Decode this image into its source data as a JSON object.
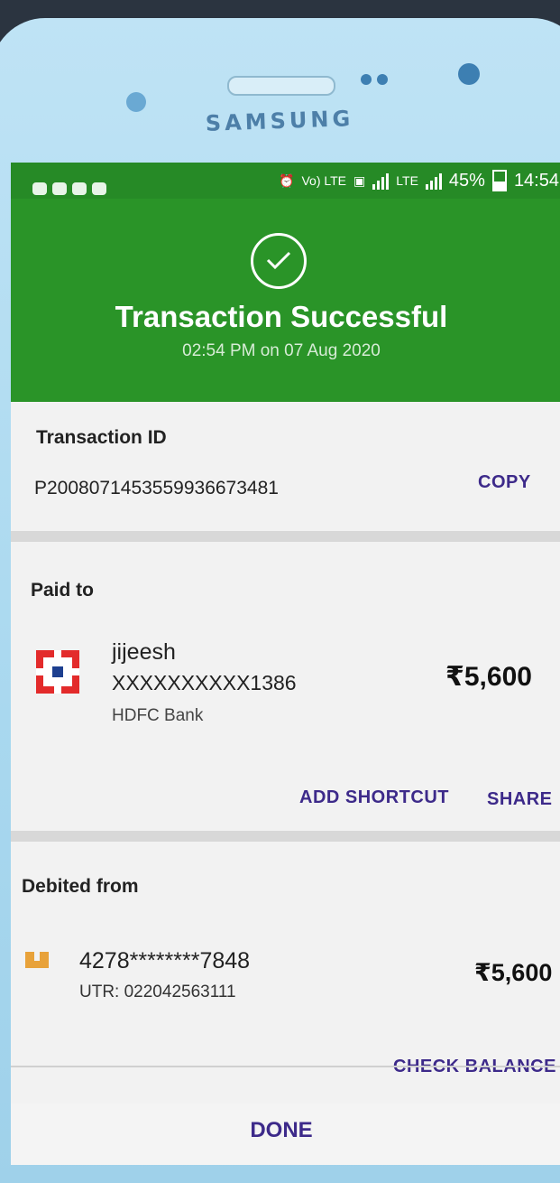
{
  "device": {
    "brand": "SAMSUNG"
  },
  "status_bar": {
    "network_label": "Vo) LTE",
    "lte_label": "LTE",
    "battery_percent": "45%",
    "time": "14:54",
    "battery_level": 0.45
  },
  "header": {
    "title": "Transaction Successful",
    "timestamp": "02:54 PM on 07 Aug 2020",
    "accent_color": "#2a9428"
  },
  "transaction": {
    "id_label": "Transaction ID",
    "id_value": "P2008071453559936673481",
    "copy_label": "COPY"
  },
  "paid_to": {
    "section_label": "Paid to",
    "name": "jijeesh",
    "account": "XXXXXXXXXX1386",
    "bank": "HDFC Bank",
    "amount": "₹5,600",
    "add_shortcut_label": "ADD SHORTCUT",
    "share_label": "SHARE"
  },
  "debited_from": {
    "section_label": "Debited from",
    "card_number": "4278********7848",
    "utr": "UTR: 022042563111",
    "amount": "₹5,600",
    "check_balance_label": "CHECK BALANCE"
  },
  "footer": {
    "done_label": "DONE"
  }
}
